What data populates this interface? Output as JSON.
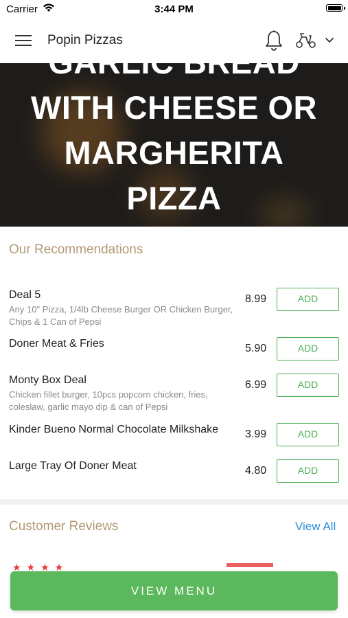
{
  "status_bar": {
    "carrier": "Carrier",
    "time": "3:44 PM"
  },
  "nav": {
    "title": "Popin Pizzas",
    "icons": [
      "menu-icon",
      "bell-icon",
      "scooter-icon",
      "chevron-down-icon"
    ]
  },
  "hero": {
    "lines": [
      "GARLIC BREAD",
      "WITH CHEESE OR",
      "MARGHERITA",
      "PIZZA"
    ]
  },
  "recommendations": {
    "title": "Our Recommendations",
    "add_label": "ADD",
    "items": [
      {
        "name": "Deal 5",
        "description": "Any 10\" Pizza, 1/4lb Cheese Burger OR Chicken Burger, Chips & 1 Can of Pepsi",
        "price": "8.99"
      },
      {
        "name": "Doner Meat & Fries",
        "description": "",
        "price": "5.90"
      },
      {
        "name": "Monty Box Deal",
        "description": "Chicken fillet burger, 10pcs popcorn chicken, fries, coleslaw, garlic mayo dip & can of Pepsi",
        "price": "6.99"
      },
      {
        "name": "Kinder Bueno Normal Chocolate Milkshake",
        "description": "",
        "price": "3.99"
      },
      {
        "name": "Large Tray Of Doner Meat",
        "description": "",
        "price": "4.80"
      }
    ]
  },
  "reviews": {
    "title": "Customer Reviews",
    "view_all": "View All"
  },
  "footer": {
    "view_menu": "VIEW MENU"
  },
  "colors": {
    "accent_green": "#5cb85c",
    "section_title": "#b19a73",
    "link_blue": "#2a8fd6"
  }
}
